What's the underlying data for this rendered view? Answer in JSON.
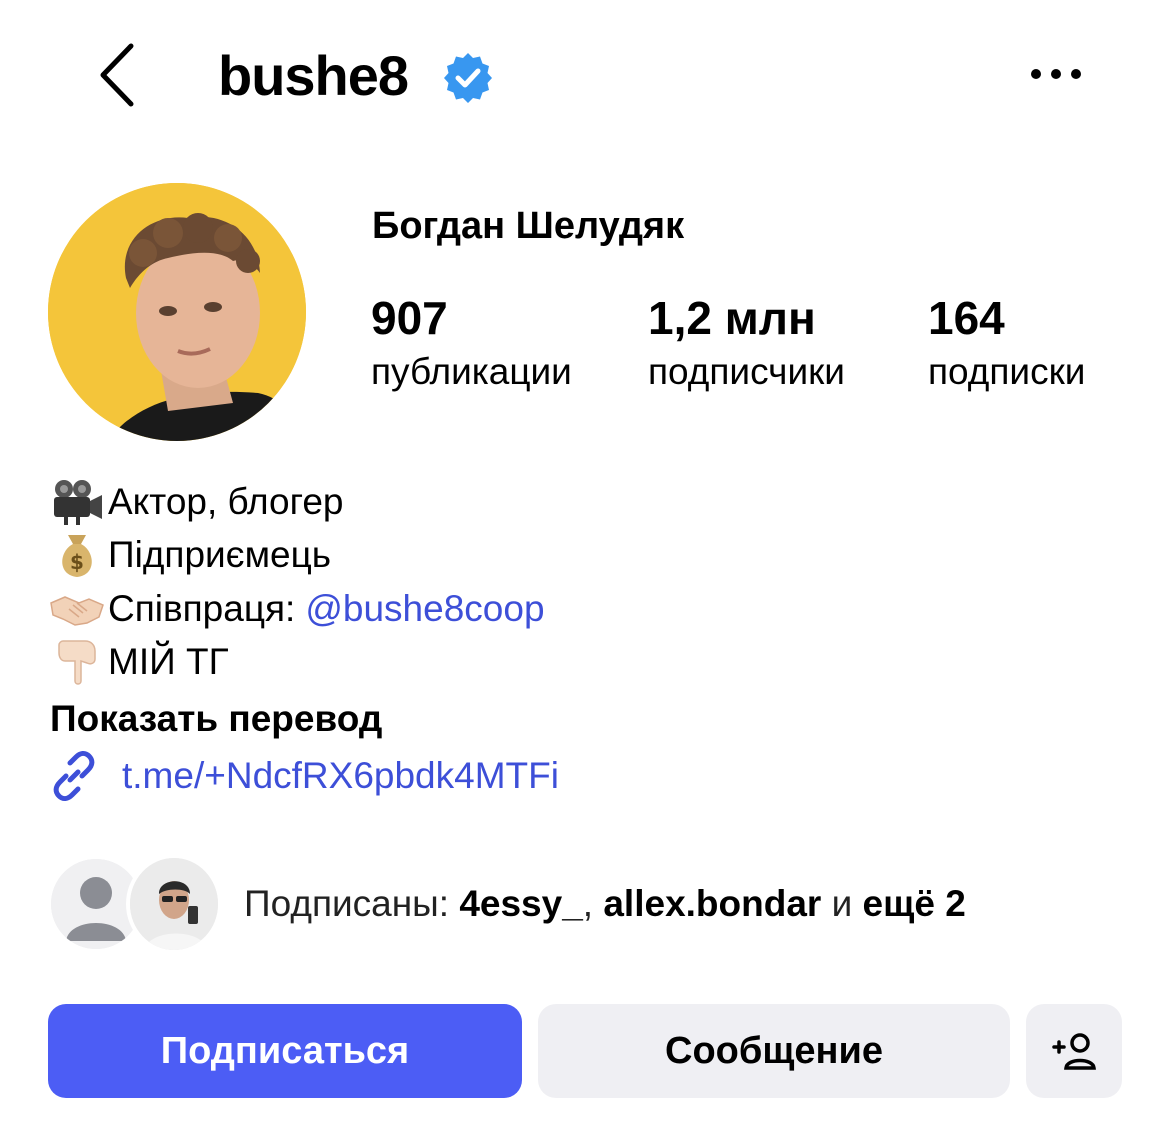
{
  "header": {
    "username": "bushe8",
    "verified": true,
    "back_icon": "chevron-left-icon",
    "more_icon": "more-horizontal-icon"
  },
  "profile": {
    "full_name": "Богдан Шелудяк",
    "avatar_bg": "#f4c53a"
  },
  "stats": [
    {
      "value": "907",
      "label": "публикации"
    },
    {
      "value": "1,2 млн",
      "label": "подписчики"
    },
    {
      "value": "164",
      "label": "подписки"
    }
  ],
  "bio": {
    "lines": [
      {
        "emoji": "movie-camera-icon",
        "text": "Актор, блогер"
      },
      {
        "emoji": "money-bag-icon",
        "text": "Підприємець"
      },
      {
        "emoji": "handshake-icon",
        "text": "Співпраця:",
        "mention": "@bushe8coop"
      },
      {
        "emoji": "pointing-down-icon",
        "text": "МІЙ ТГ"
      }
    ],
    "show_translation": "Показать перевод",
    "link": "t.me/+NdcfRX6pbdk4MTFi"
  },
  "followed_by": {
    "prefix": "Подписаны:",
    "user1": "4essy_",
    "separator": ",",
    "user2": "allex.bondar",
    "connector": "и",
    "more": "ещё 2"
  },
  "actions": {
    "follow": "Подписаться",
    "message": "Сообщение",
    "add_user_icon": "add-user-icon"
  },
  "colors": {
    "accent": "#4c5df5",
    "link": "#3d4fd8",
    "secondary_button": "#efeff3",
    "verified": "#3897f0"
  }
}
